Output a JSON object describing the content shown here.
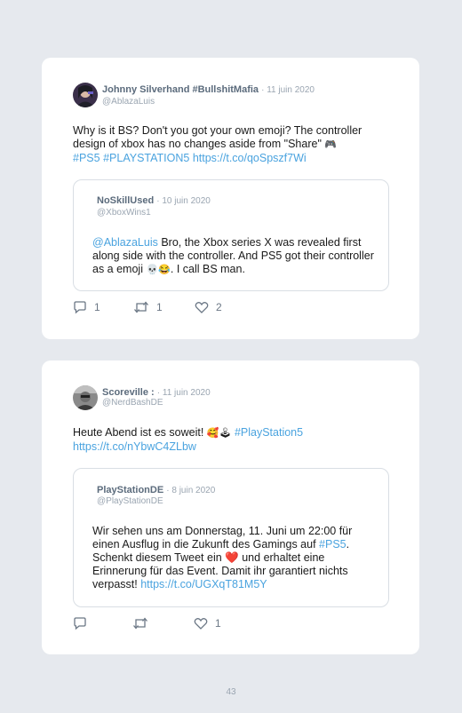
{
  "tweets": [
    {
      "author_name": "Johnny Silverhand #BullshitMafia",
      "date": "· 11 juin 2020",
      "handle": "@AblazaLuis",
      "text_1": "Why is it BS? Don't you got your own emoji? The controller design of xbox has no changes aside from \"Share\"",
      "emoji_1": "🎮",
      "link_hashtag_1": "#PS5",
      "link_hashtag_2": "#PLAYSTATION5",
      "link_url": "https://t.co/qoSpszf7Wi",
      "quote": {
        "author_name": "NoSkillUsed",
        "date": "· 10 juin 2020",
        "handle": "@XboxWins1",
        "mention": "@AblazaLuis",
        "text_1": "Bro, the Xbox series X was revealed first along side with the controller. And PS5 got their controller as a emoji",
        "emoji": "💀😂",
        "text_2": ". I call BS man."
      },
      "replies": "1",
      "retweets": "1",
      "likes": "2"
    },
    {
      "author_name": "Scoreville :",
      "date": "· 11 juin 2020",
      "handle": "@NerdBashDE",
      "text_1": "Heute Abend ist es soweit!",
      "emoji_1": "🥰🕹",
      "link_hashtag_1": "#PlayStation5",
      "link_url": "https://t.co/nYbwC4ZLbw",
      "quote": {
        "author_name": "PlayStationDE",
        "date": "· 8 juin 2020",
        "handle": "@PlayStationDE",
        "text_1": "Wir sehen uns am Donnerstag, 11. Juni um 22:00 für einen Ausflug in die Zukunft des Gamings auf",
        "hashtag": "#PS5",
        "text_2": ". Schenkt diesem Tweet ein",
        "emoji": "❤️",
        "text_3": "und erhaltet eine Erinnerung für das Event. Damit ihr garantiert nichts verpasst!",
        "link_url": "https://t.co/UGXqT81M5Y"
      },
      "replies": "",
      "retweets": "",
      "likes": "1"
    }
  ],
  "page_number": "43",
  "colors": {
    "background": "#e6e9ee",
    "card": "#ffffff",
    "link": "#4aa3df",
    "meta": "#9aa5b1"
  }
}
